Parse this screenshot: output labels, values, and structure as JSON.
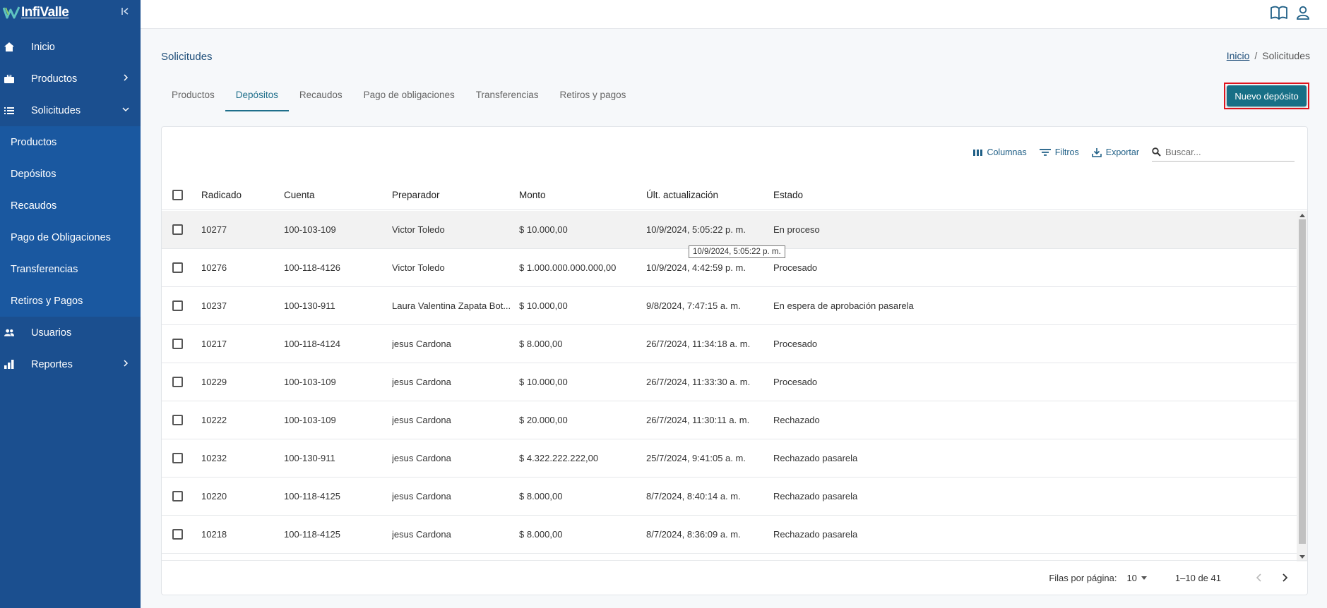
{
  "brand": {
    "name": "InfiValle"
  },
  "sidebar": {
    "items": [
      {
        "label": "Inicio",
        "icon": "home-icon"
      },
      {
        "label": "Productos",
        "icon": "briefcase-icon",
        "expandable": true
      },
      {
        "label": "Solicitudes",
        "icon": "list-icon",
        "expanded": true
      }
    ],
    "subitems": [
      {
        "label": "Productos"
      },
      {
        "label": "Depósitos"
      },
      {
        "label": "Recaudos"
      },
      {
        "label": "Pago de Obligaciones"
      },
      {
        "label": "Transferencias"
      },
      {
        "label": "Retiros y Pagos"
      }
    ],
    "items_after": [
      {
        "label": "Usuarios",
        "icon": "users-icon"
      },
      {
        "label": "Reportes",
        "icon": "chart-icon",
        "expandable": true
      }
    ]
  },
  "header": {
    "icons": [
      "book-icon",
      "user-icon"
    ]
  },
  "page": {
    "title": "Solicitudes",
    "breadcrumb": {
      "home": "Inicio",
      "current": "Solicitudes"
    }
  },
  "tabs": [
    {
      "label": "Productos"
    },
    {
      "label": "Depósitos",
      "active": true
    },
    {
      "label": "Recaudos"
    },
    {
      "label": "Pago de obligaciones"
    },
    {
      "label": "Transferencias"
    },
    {
      "label": "Retiros y pagos"
    }
  ],
  "new_button": {
    "label": "Nuevo depósito"
  },
  "toolbar": {
    "columns": "Columnas",
    "filters": "Filtros",
    "export": "Exportar",
    "search_placeholder": "Buscar..."
  },
  "table": {
    "headers": [
      "Radicado",
      "Cuenta",
      "Preparador",
      "Monto",
      "Últ. actualización",
      "Estado"
    ],
    "rows": [
      [
        "10277",
        "100-103-109",
        "Victor Toledo",
        "$ 10.000,00",
        "10/9/2024, 5:05:22 p. m.",
        "En proceso"
      ],
      [
        "10276",
        "100-118-4126",
        "Victor Toledo",
        "$ 1.000.000.000.000,00",
        "10/9/2024, 4:42:59 p. m.",
        "Procesado"
      ],
      [
        "10237",
        "100-130-911",
        "Laura Valentina Zapata Bot...",
        "$ 10.000,00",
        "9/8/2024, 7:47:15 a. m.",
        "En espera de aprobación pasarela"
      ],
      [
        "10217",
        "100-118-4124",
        "jesus Cardona",
        "$ 8.000,00",
        "26/7/2024, 11:34:18 a. m.",
        "Procesado"
      ],
      [
        "10229",
        "100-103-109",
        "jesus Cardona",
        "$ 10.000,00",
        "26/7/2024, 11:33:30 a. m.",
        "Procesado"
      ],
      [
        "10222",
        "100-103-109",
        "jesus Cardona",
        "$ 20.000,00",
        "26/7/2024, 11:30:11 a. m.",
        "Rechazado"
      ],
      [
        "10232",
        "100-130-911",
        "jesus Cardona",
        "$ 4.322.222.222,00",
        "25/7/2024, 9:41:05 a. m.",
        "Rechazado pasarela"
      ],
      [
        "10220",
        "100-118-4125",
        "jesus Cardona",
        "$ 8.000,00",
        "8/7/2024, 8:40:14 a. m.",
        "Rechazado pasarela"
      ],
      [
        "10218",
        "100-118-4125",
        "jesus Cardona",
        "$ 8.000,00",
        "8/7/2024, 8:36:09 a. m.",
        "Rechazado pasarela"
      ]
    ],
    "tooltip": "10/9/2024, 5:05:22 p. m."
  },
  "pagination": {
    "rows_per_page_label": "Filas por página:",
    "rows_per_page": "10",
    "range": "1–10 de 41"
  },
  "colors": {
    "sidebar": "#1b4f8f",
    "sidebar_sub": "#1a58a0",
    "accent": "#176f86",
    "highlight_outline": "#e0141e"
  }
}
